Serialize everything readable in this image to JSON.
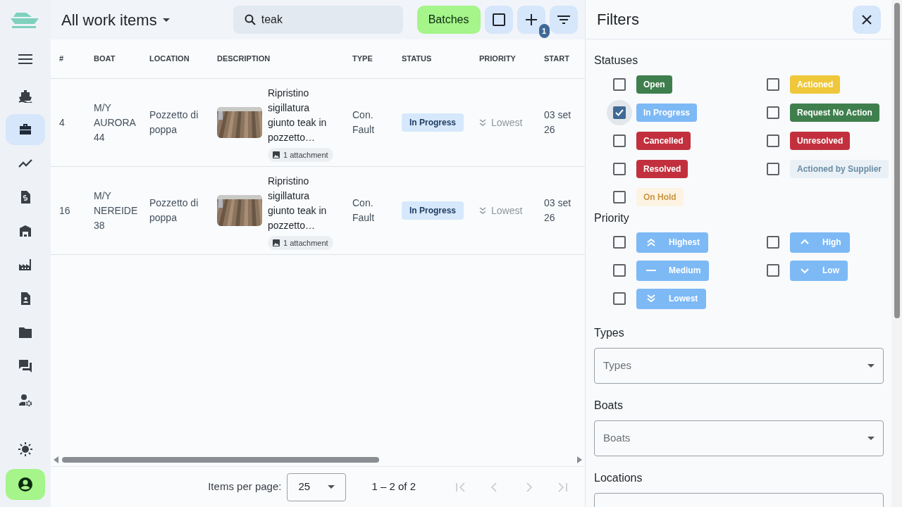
{
  "header": {
    "title": "All work items",
    "search": {
      "value": "teak"
    },
    "batches_button": "Batches",
    "filter_badge": "1"
  },
  "sidebar": {
    "items": [
      {
        "selected": false
      },
      {
        "selected": true
      },
      {
        "selected": false
      },
      {
        "selected": false
      },
      {
        "selected": false
      },
      {
        "selected": false
      },
      {
        "selected": false
      },
      {
        "selected": false
      },
      {
        "selected": false
      },
      {
        "selected": false
      }
    ]
  },
  "table": {
    "columns": [
      "#",
      "BOAT",
      "LOCATION",
      "DESCRIPTION",
      "TYPE",
      "STATUS",
      "PRIORITY",
      "START"
    ],
    "rows": [
      {
        "number": "4",
        "boat": "M/Y AURORA 44",
        "location": "Pozzetto di poppa",
        "description": "Ripristino sigillatura giunto teak in pozzetto…",
        "attachments": "1 attachment",
        "type": "Con. Fault",
        "status": "In Progress",
        "priority": "Lowest",
        "start": "03 set 26"
      },
      {
        "number": "16",
        "boat": "M/Y NEREIDE 38",
        "location": "Pozzetto di poppa",
        "description": "Ripristino sigillatura giunto teak in pozzetto…",
        "attachments": "1 attachment",
        "type": "Con. Fault",
        "status": "In Progress",
        "priority": "Lowest",
        "start": "03 set 26"
      }
    ]
  },
  "pagination": {
    "label": "Items per page:",
    "page_size": "25",
    "range": "1 – 2 of 2"
  },
  "filters": {
    "title": "Filters",
    "statuses_label": "Statuses",
    "statuses": [
      {
        "label": "Open",
        "checked": false,
        "color": "#3f7f4d"
      },
      {
        "label": "Actioned",
        "checked": false,
        "color": "#efc73a"
      },
      {
        "label": "In Progress",
        "checked": true,
        "color": "#7db9f5"
      },
      {
        "label": "Request No Action",
        "checked": false,
        "color": "#3f7f4d"
      },
      {
        "label": "Cancelled",
        "checked": false,
        "color": "#c2303e"
      },
      {
        "label": "Unresolved",
        "checked": false,
        "color": "#c2303e"
      },
      {
        "label": "Resolved",
        "checked": false,
        "color": "#c2303e"
      },
      {
        "label": "Actioned by Supplier",
        "checked": false,
        "color": "#eaf1f6"
      },
      {
        "label": "On Hold",
        "checked": false,
        "color": "#fdf3e2"
      }
    ],
    "priority_label": "Priority",
    "priorities": [
      {
        "label": "Highest",
        "kind": "highest",
        "checked": false
      },
      {
        "label": "High",
        "kind": "high",
        "checked": false
      },
      {
        "label": "Medium",
        "kind": "medium",
        "checked": false
      },
      {
        "label": "Low",
        "kind": "low",
        "checked": false
      },
      {
        "label": "Lowest",
        "kind": "lowest",
        "checked": false
      }
    ],
    "fields": [
      {
        "label": "Types",
        "placeholder": "Types"
      },
      {
        "label": "Boats",
        "placeholder": "Boats"
      },
      {
        "label": "Locations"
      }
    ]
  }
}
